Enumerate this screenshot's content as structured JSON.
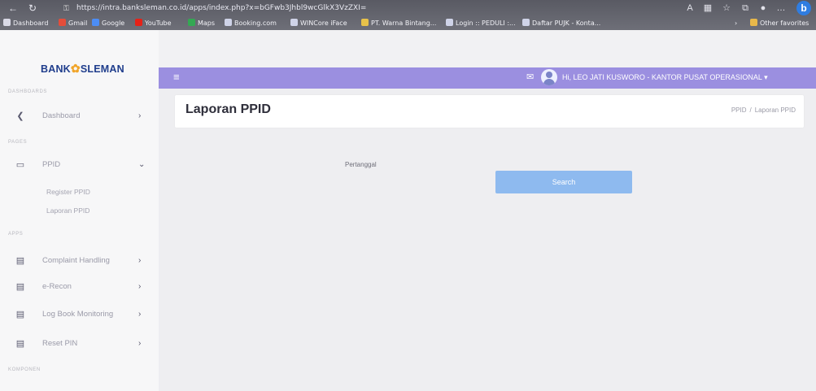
{
  "browser": {
    "url": "https://intra.banksleman.co.id/apps/index.php?x=bGFwb3Jhbl9wcGlkX3VzZXI=",
    "profile_initial": "b",
    "favorites": [
      {
        "label": "Dashboard",
        "color": "#d9d9e6"
      },
      {
        "label": "Gmail",
        "color": "#e44d3a"
      },
      {
        "label": "Google",
        "color": "#4c8df5"
      },
      {
        "label": "YouTube",
        "color": "#e62117"
      },
      {
        "label": "Maps",
        "color": "#34a853"
      },
      {
        "label": "Booking.com",
        "color": "#cfd3e8"
      },
      {
        "label": "WINCore iFace",
        "color": "#cfd3e8"
      },
      {
        "label": "PT. Warna Bintang...",
        "color": "#e8c24a"
      },
      {
        "label": "Login :: PEDULI :...",
        "color": "#cfd3e8"
      },
      {
        "label": "Daftar PUJK - Konta...",
        "color": "#cfd3e8"
      }
    ],
    "other_favorites": "Other favorites"
  },
  "sidebar": {
    "logo": {
      "left": "BANK",
      "right": "SLEMAN",
      "accent_color": "#f1a52a"
    },
    "sections": {
      "dashboards": "DASHBOARDS",
      "pages": "PAGES",
      "apps": "APPS",
      "components": "KOMPONEN"
    },
    "items": {
      "dashboard": {
        "label": "Dashboard",
        "icon": "dashboard-icon"
      },
      "ppid": {
        "label": "PPID",
        "icon": "monitor-icon"
      },
      "complaint": {
        "label": "Complaint Handling",
        "icon": "calendar-icon"
      },
      "erecon": {
        "label": "e-Recon",
        "icon": "calendar-icon"
      },
      "logbook": {
        "label": "Log Book Monitoring",
        "icon": "calendar-icon"
      },
      "reset_pin": {
        "label": "Reset PIN",
        "icon": "calendar-icon"
      }
    },
    "ppid_sub": {
      "register": "Register PPID",
      "laporan": "Laporan PPID"
    }
  },
  "header": {
    "user": "Hi, LEO JATI KUSWORO - KANTOR PUSAT OPERASIONAL",
    "accent_color": "#9b8fe0"
  },
  "page": {
    "title": "Laporan PPID",
    "breadcrumb": [
      "PPID",
      "Laporan PPID"
    ],
    "form_label": "Pertanggal",
    "search_button": "Search",
    "button_color": "#8ebaef"
  }
}
